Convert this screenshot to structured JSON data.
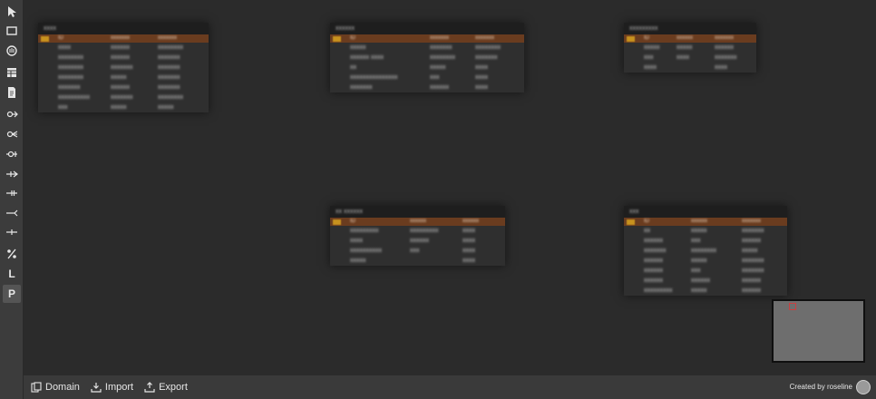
{
  "toolbar": {
    "tools": [
      {
        "name": "pointer-tool-icon"
      },
      {
        "name": "select-rect-tool-icon"
      },
      {
        "name": "hand-tool-icon"
      },
      {
        "name": "table-tool-icon"
      },
      {
        "name": "note-tool-icon"
      },
      {
        "name": "relation-1-icon"
      },
      {
        "name": "relation-2-icon"
      },
      {
        "name": "relation-3-icon"
      },
      {
        "name": "relation-4-icon"
      },
      {
        "name": "relation-5-icon"
      },
      {
        "name": "relation-6-icon"
      },
      {
        "name": "relation-7-icon"
      },
      {
        "name": "relation-percent-icon"
      }
    ],
    "letter_l": "L",
    "letter_p": "P"
  },
  "tables": [
    {
      "name": "xxxx",
      "cols": [
        "ID",
        "xxxxxxx",
        "xxxxxxx"
      ],
      "rows": [
        [
          "xxxx",
          "xxxxxx",
          "xxxxxxxx"
        ],
        [
          "xxxxxxxx",
          "xxxxxx",
          "xxxxxxx"
        ],
        [
          "xxxxxxxx",
          "xxxxxxx",
          "xxxxxxx"
        ],
        [
          "xxxxxxxx",
          "xxxxx",
          "xxxxxxx"
        ],
        [
          "xxxxxxx",
          "xxxxxx",
          "xxxxxxx"
        ],
        [
          "xxxxxxxxxx",
          "xxxxxxx",
          "xxxxxxxx"
        ],
        [
          "xxx",
          "xxxxx",
          "xxxxx"
        ]
      ]
    },
    {
      "name": "xxxxxx",
      "cols": [
        "ID",
        "xxxxxxx",
        "xxxxxxx"
      ],
      "rows": [
        [
          "xxxxx",
          "xxxxxxx",
          "xxxxxxxx"
        ],
        [
          "xxxxxx xxxx",
          "xxxxxxxx",
          "xxxxxxx"
        ],
        [
          "xx",
          "xxxxx",
          "xxxx"
        ],
        [
          "xxxxxxxxxxxxxxx",
          "xxx",
          "xxxx"
        ],
        [
          "xxxxxxx",
          "xxxxxx",
          "xxxx"
        ]
      ]
    },
    {
      "name": "xxxxxxxxx",
      "cols": [
        "ID",
        "xxxxxx",
        "xxxxxxx"
      ],
      "rows": [
        [
          "xxxxx",
          "xxxxx",
          "xxxxxx"
        ],
        [
          "xxx",
          "xxxx",
          "xxxxxxx"
        ],
        [
          "xxxx",
          "",
          "xxxx"
        ]
      ]
    },
    {
      "name": "xx xxxxxx",
      "cols": [
        "ID",
        "xxxxxx",
        "xxxxxx"
      ],
      "rows": [
        [
          "xxxxxxxxx",
          "xxxxxxxxx",
          "xxxx"
        ],
        [
          "xxxx",
          "xxxxxx",
          "xxxx"
        ],
        [
          "xxxxxxxxxx",
          "xxx",
          "xxxx"
        ],
        [
          "xxxxx",
          "",
          "xxxx"
        ]
      ]
    },
    {
      "name": "xxx",
      "cols": [
        "ID",
        "xxxxxx",
        "xxxxxxx"
      ],
      "rows": [
        [
          "xx",
          "xxxxx",
          "xxxxxxx"
        ],
        [
          "xxxxxx",
          "xxx",
          "xxxxxx"
        ],
        [
          "xxxxxxx",
          "xxxxxxxx",
          "xxxxx"
        ],
        [
          "xxxxxx",
          "xxxxx",
          "xxxxxxx"
        ],
        [
          "xxxxxx",
          "xxx",
          "xxxxxxx"
        ],
        [
          "xxxxxx",
          "xxxxxx",
          "xxxxxx"
        ],
        [
          "xxxxxxxxx",
          "xxxxx",
          "xxxxxx"
        ]
      ]
    }
  ],
  "bottombar": {
    "domain_label": "Domain",
    "import_label": "Import",
    "export_label": "Export",
    "credit": "Created by roseline"
  },
  "colors": {
    "canvas": "#2b2b2b",
    "column_header": "#6a3c1f",
    "key_icon": "#c8921e"
  }
}
